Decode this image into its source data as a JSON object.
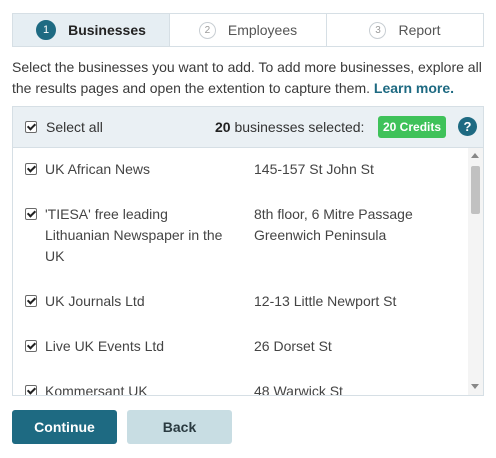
{
  "steps": [
    {
      "number": "1",
      "label": "Businesses",
      "active": true
    },
    {
      "number": "2",
      "label": "Employees",
      "active": false
    },
    {
      "number": "3",
      "label": "Report",
      "active": false
    }
  ],
  "instructions": {
    "text": "Select the businesses you want to add. To add more businesses, explore all the results pages and open the extention to capture them. ",
    "learn_more": "Learn more."
  },
  "header": {
    "select_all_label": "Select all",
    "selected_count": "20",
    "selected_text": " businesses selected:",
    "credits_badge": "20 Credits",
    "help_label": "?"
  },
  "businesses": [
    {
      "name": "UK African News",
      "address": "145-157 St John St",
      "checked": true
    },
    {
      "name": "'TIESA' free leading Lithuanian Newspaper in the UK",
      "address": "8th floor, 6 Mitre Passage Greenwich Peninsula",
      "checked": true
    },
    {
      "name": "UK Journals Ltd",
      "address": "12-13 Little Newport St",
      "checked": true
    },
    {
      "name": "Live UK Events Ltd",
      "address": "26 Dorset St",
      "checked": true
    },
    {
      "name": "Kommersant UK",
      "address": "48 Warwick St",
      "checked": true
    }
  ],
  "buttons": {
    "continue_label": "Continue",
    "back_label": "Back"
  },
  "colors": {
    "primary": "#1e6a82",
    "credits_green": "#3fc25a",
    "header_bg": "#eaf0f4",
    "back_button_bg": "#c8dde3"
  }
}
